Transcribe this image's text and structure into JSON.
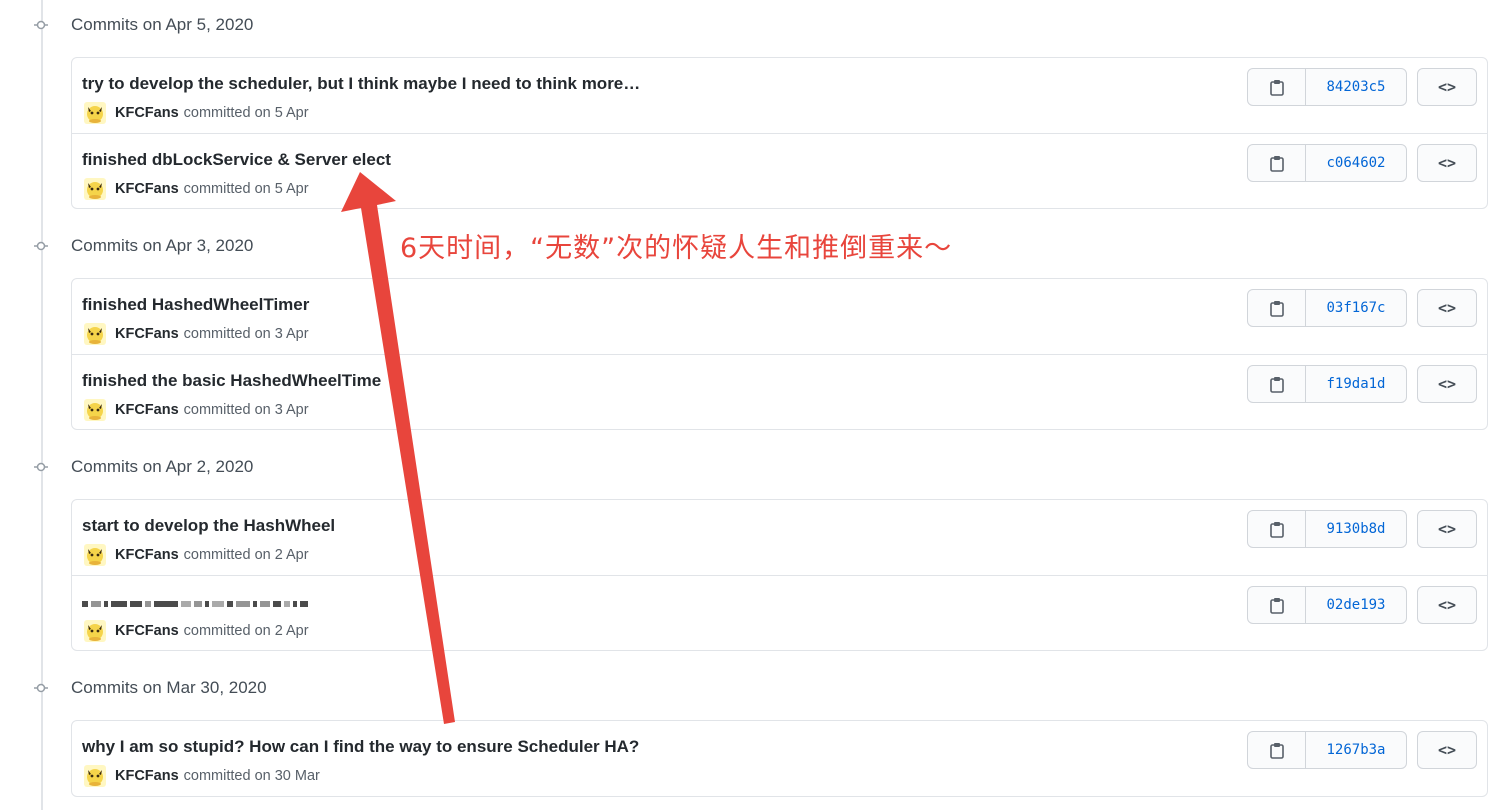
{
  "groups": [
    {
      "header": "Commits on Apr 5, 2020",
      "commits": [
        {
          "message": "try to develop the scheduler, but I think maybe I need to think more…",
          "author": "KFCFans",
          "committed": "committed on 5 Apr",
          "sha": "84203c5"
        },
        {
          "message": "finished dbLockService & Server elect",
          "author": "KFCFans",
          "committed": "committed on 5 Apr",
          "sha": "c064602"
        }
      ]
    },
    {
      "header": "Commits on Apr 3, 2020",
      "commits": [
        {
          "message": "finished HashedWheelTimer",
          "author": "KFCFans",
          "committed": "committed on 3 Apr",
          "sha": "03f167c"
        },
        {
          "message": "finished the basic HashedWheelTime",
          "author": "KFCFans",
          "committed": "committed on 3 Apr",
          "sha": "f19da1d"
        }
      ]
    },
    {
      "header": "Commits on Apr 2, 2020",
      "commits": [
        {
          "message": "start to develop the HashWheel",
          "author": "KFCFans",
          "committed": "committed on 2 Apr",
          "sha": "9130b8d"
        },
        {
          "message": "",
          "author": "KFCFans",
          "committed": "committed on 2 Apr",
          "sha": "02de193"
        }
      ]
    },
    {
      "header": "Commits on Mar 30, 2020",
      "commits": [
        {
          "message": "why I am so stupid? How can I find the way to ensure Scheduler HA?",
          "author": "KFCFans",
          "committed": "committed on 30 Mar",
          "sha": "1267b3a"
        }
      ]
    }
  ],
  "annotation": "6天时间，“无数”次的怀疑人生和推倒重来～",
  "colors": {
    "accent": "#0366d6",
    "annotation": "#e8453c",
    "border": "#e1e4e8"
  },
  "icons": {
    "copy": "clipboard-icon",
    "browse": "code-brackets-icon",
    "node": "commit-node-icon"
  }
}
